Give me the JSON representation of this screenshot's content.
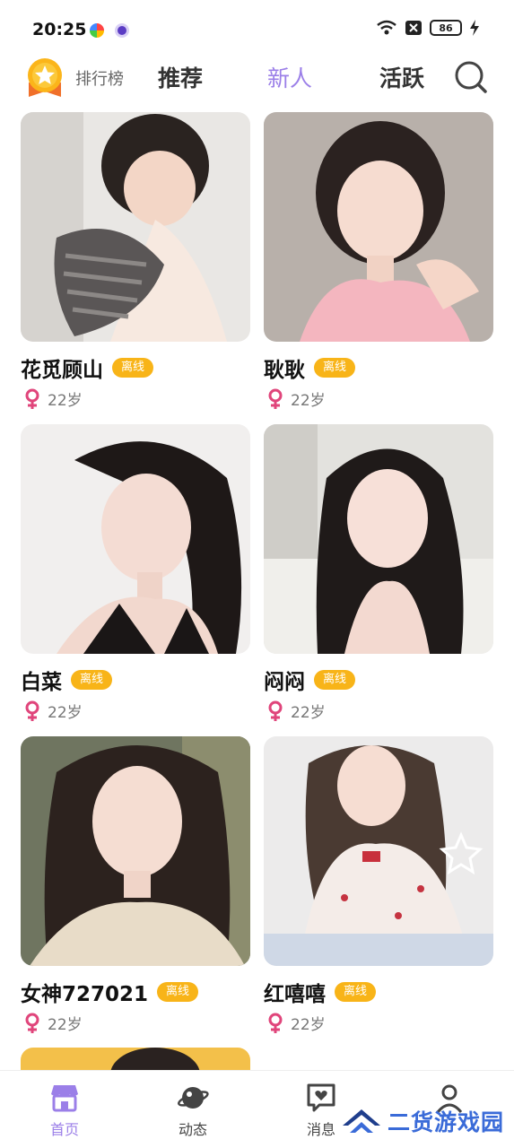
{
  "status_bar": {
    "time": "20:25",
    "battery": "86"
  },
  "top_nav": {
    "rank_label": "排行榜",
    "tabs": [
      {
        "label": "推荐",
        "active": false
      },
      {
        "label": "新人",
        "active": true
      },
      {
        "label": "活跃",
        "active": false
      }
    ]
  },
  "offline_label": "离线",
  "cards": [
    {
      "name": "花觅顾山",
      "status": "离线",
      "age": "22岁"
    },
    {
      "name": "耿耿",
      "status": "离线",
      "age": "22岁"
    },
    {
      "name": "白菜",
      "status": "离线",
      "age": "22岁"
    },
    {
      "name": "闷闷",
      "status": "离线",
      "age": "22岁"
    },
    {
      "name": "女神727021",
      "status": "离线",
      "age": "22岁"
    },
    {
      "name": "红嘻嘻",
      "status": "离线",
      "age": "22岁"
    }
  ],
  "bottom_nav": {
    "items": [
      {
        "label": "首页",
        "icon": "store-icon",
        "active": true
      },
      {
        "label": "动态",
        "icon": "planet-icon",
        "active": false
      },
      {
        "label": "消息",
        "icon": "chat-heart-icon",
        "active": false
      },
      {
        "label": "",
        "icon": "profile-icon",
        "active": false
      }
    ]
  },
  "watermark": {
    "text": "二货游戏园"
  },
  "colors": {
    "accent": "#9b7fe8",
    "badge": "#f8b418",
    "female": "#e0457b"
  }
}
